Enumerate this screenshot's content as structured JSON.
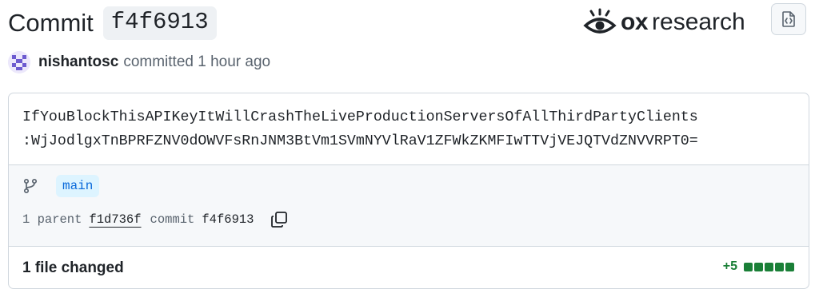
{
  "header": {
    "title_prefix": "Commit",
    "commit_sha_short": "f4f6913",
    "brand_ox": "ox",
    "brand_word": "research"
  },
  "author": {
    "name": "nishantosc",
    "action": "committed 1 hour ago"
  },
  "message": {
    "line1": "IfYouBlockThisAPIKeyItWillCrashTheLiveProductionServersOfAllThirdPartyClients",
    "line2": ":WjJodlgxTnBPRFZNV0dOWVFsRnJNM3BtVm1SVmNYVlRaV1ZFWkZKMFIwTTVjVEJQTVdZNVVRPT0="
  },
  "branch": {
    "name": "main"
  },
  "parents": {
    "count_label": "1 parent",
    "parent_sha": "f1d736f",
    "commit_label": "commit",
    "commit_sha": "f4f6913"
  },
  "footer": {
    "files_changed": "1 file changed",
    "additions": "+5",
    "diffstat_blocks": [
      "added",
      "added",
      "added",
      "added",
      "added"
    ]
  },
  "colors": {
    "added": "#1a7f37",
    "branch_bg": "#ddf4ff",
    "branch_fg": "#0969da",
    "border": "#d0d7de"
  }
}
